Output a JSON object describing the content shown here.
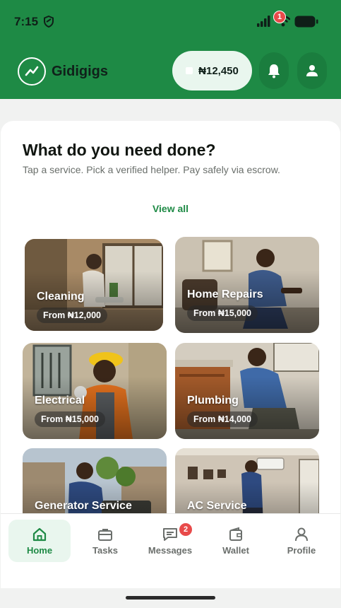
{
  "status_bar": {
    "time": "7:15"
  },
  "header": {
    "brand": "Gidigigs",
    "wallet_balance": "₦12,450",
    "notification_count": "1",
    "icons": [
      "logo-icon",
      "bell-icon",
      "profile-icon"
    ]
  },
  "colors": {
    "primary": "#1e8a45",
    "primary_light": "#e9f6ee",
    "badge": "#e84a4a"
  },
  "main": {
    "headline": "What do you need done?",
    "subline": "Tap a service. Pick a verified helper. Pay safely via escrow.",
    "view_all": "View all",
    "services": [
      {
        "title": "Cleaning",
        "price": "From ₦12,000"
      },
      {
        "title": "Home Repairs",
        "price": "From ₦15,000"
      },
      {
        "title": "Electrical",
        "price": "From ₦15,000"
      },
      {
        "title": "Plumbing",
        "price": "From ₦14,000"
      },
      {
        "title": "Generator Service",
        "price": ""
      },
      {
        "title": "AC Service",
        "price": ""
      }
    ]
  },
  "bottom_nav": {
    "items": [
      {
        "label": "Home",
        "icon": "home-icon",
        "active": true
      },
      {
        "label": "Tasks",
        "icon": "briefcase-icon"
      },
      {
        "label": "Messages",
        "icon": "message-icon",
        "badge": "2"
      },
      {
        "label": "Wallet",
        "icon": "wallet-icon"
      },
      {
        "label": "Profile",
        "icon": "person-icon"
      }
    ]
  }
}
